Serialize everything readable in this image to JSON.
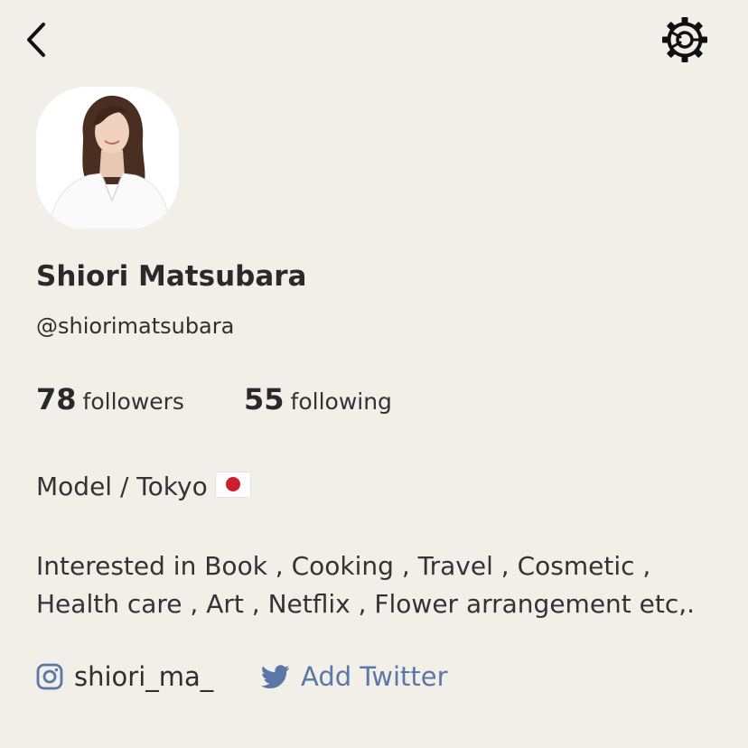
{
  "header": {
    "back_icon": "chevron-left-icon",
    "settings_icon": "gear-icon"
  },
  "profile": {
    "name": "Shiori Matsubara",
    "handle": "@shiorimatsubara",
    "followers_count": "78",
    "followers_label": "followers",
    "following_count": "55",
    "following_label": "following",
    "bio_line1": "Model / Tokyo",
    "bio_flag_icon": "japan-flag-icon",
    "bio_line2": "Interested in Book , Cooking , Travel , Cosmetic ,",
    "bio_line3": "Health care , Art , Netflix , Flower arrangement etc,."
  },
  "links": {
    "instagram_icon": "instagram-icon",
    "instagram_handle": "shiori_ma_",
    "twitter_icon": "twitter-icon",
    "twitter_label": "Add Twitter"
  },
  "colors": {
    "background": "#f1efe7",
    "text": "#2b2b2b",
    "link_blue": "#5a77a8",
    "flag_red": "#cc1f2e"
  }
}
